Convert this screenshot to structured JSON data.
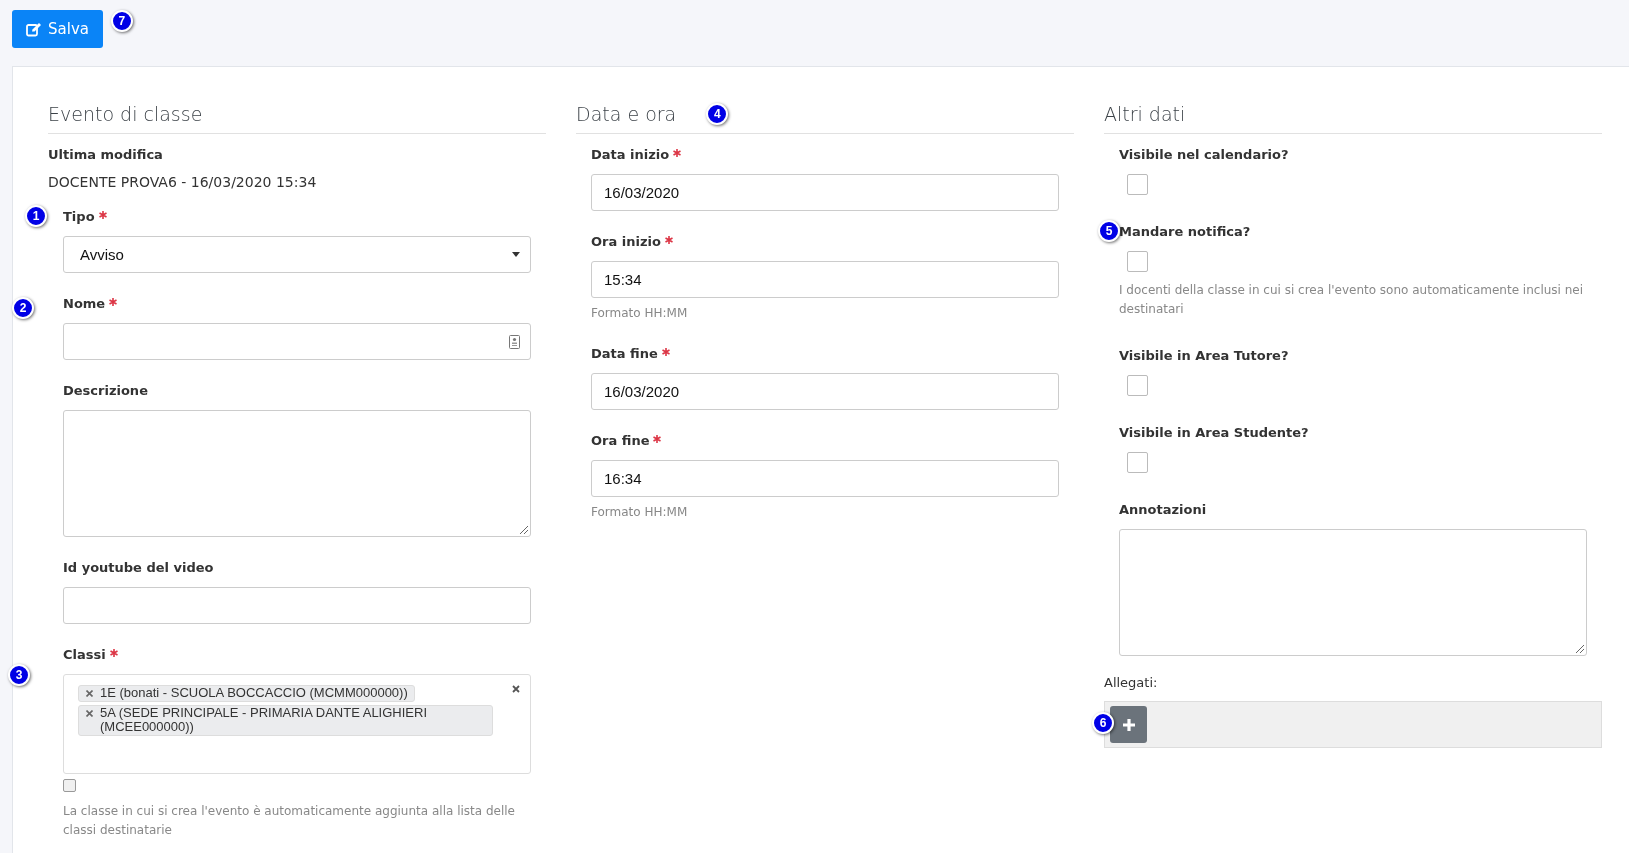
{
  "toolbar": {
    "save_button": {
      "label": "Salva",
      "callout": "7"
    }
  },
  "sections": [
    {
      "title": "Evento di classe",
      "fields": [
        {
          "kind": "static",
          "label": "Ultima modifica",
          "value": "DOCENTE PROVA6 - 16/03/2020 15:34"
        },
        {
          "kind": "select",
          "label": "Tipo",
          "required": true,
          "value": "Avviso",
          "callout": "1"
        },
        {
          "kind": "text",
          "label": "Nome",
          "required": true,
          "contact_icon": true,
          "callout": "2"
        },
        {
          "kind": "textarea",
          "label": "Descrizione"
        },
        {
          "kind": "text",
          "label": "Id youtube del video"
        },
        {
          "kind": "tags",
          "label": "Classi",
          "required": true,
          "callout": "3",
          "tags": [
            "1E (bonati - SCUOLA BOCCACCIO (MCMM000000))",
            "5A (SEDE PRINCIPALE - PRIMARIA DANTE ALIGHIERI (MCEE000000))"
          ],
          "checkbox": {
            "checked": false
          },
          "help": "La classe in cui si crea l'evento è automaticamente aggiunta alla lista delle classi destinatarie"
        }
      ]
    },
    {
      "title": "Data e ora",
      "callout": "4",
      "fields": [
        {
          "kind": "text",
          "label": "Data inizio",
          "required": true,
          "value": "16/03/2020"
        },
        {
          "kind": "text",
          "label": "Ora inizio",
          "required": true,
          "value": "15:34",
          "help": "Formato HH:MM"
        },
        {
          "kind": "text",
          "label": "Data fine",
          "required": true,
          "value": "16/03/2020"
        },
        {
          "kind": "text",
          "label": "Ora fine",
          "required": true,
          "value": "16:34",
          "help": "Formato HH:MM"
        }
      ]
    },
    {
      "title": "Altri dati",
      "fields": [
        {
          "kind": "checkbox",
          "label": "Visibile nel calendario?",
          "checked": false
        },
        {
          "kind": "checkbox",
          "label": "Mandare notifica?",
          "checked": false,
          "callout": "5",
          "help": "I docenti della classe in cui si crea l'evento sono automaticamente inclusi nei destinatari"
        },
        {
          "kind": "checkbox",
          "label": "Visibile in Area Tutore?",
          "checked": false
        },
        {
          "kind": "checkbox",
          "label": "Visibile in Area Studente?",
          "checked": false
        },
        {
          "kind": "textarea",
          "label": "Annotazioni"
        },
        {
          "kind": "attachments",
          "label": "Allegati:",
          "callout": "6"
        }
      ]
    }
  ]
}
